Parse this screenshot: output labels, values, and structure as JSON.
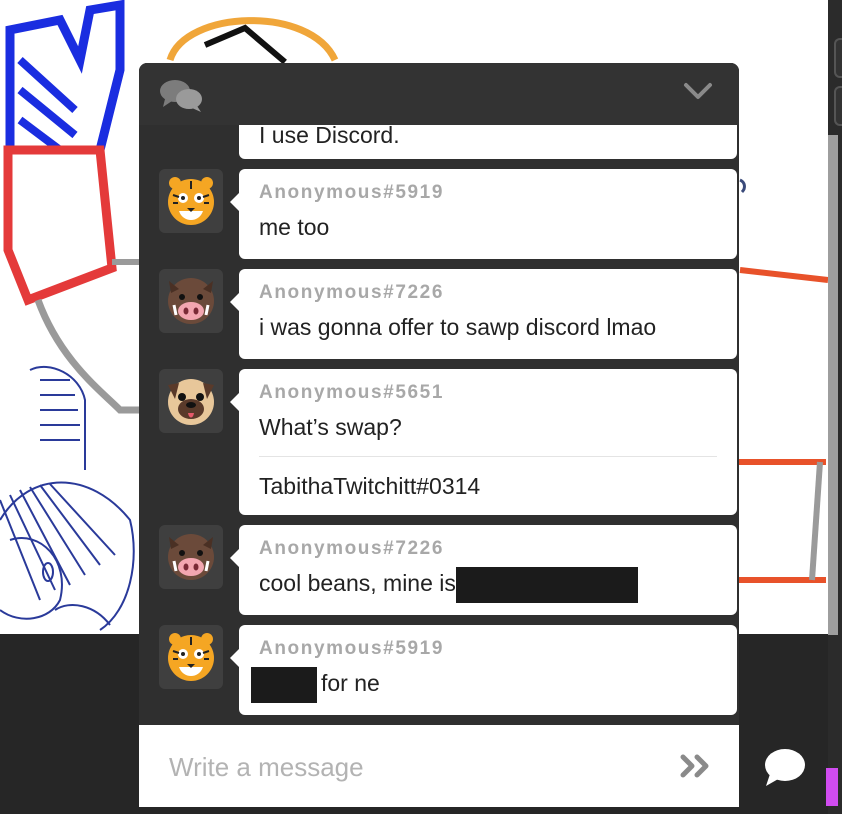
{
  "chat": {
    "header": {
      "chat_icon": "chat-bubbles-icon",
      "collapse_icon": "chevron-down-icon"
    },
    "messages": [
      {
        "author": "",
        "avatar": "",
        "text": "I use Discord.",
        "partial": true
      },
      {
        "author": "Anonymous#5919",
        "avatar": "tiger-emoji",
        "text": "me too"
      },
      {
        "author": "Anonymous#7226",
        "avatar": "boar-emoji",
        "text": "i was gonna offer to sawp discord lmao"
      },
      {
        "author": "Anonymous#5651",
        "avatar": "dog-emoji",
        "text": "What’s swap?",
        "text2": "TabithaTwitchitt#0314"
      },
      {
        "author": "Anonymous#7226",
        "avatar": "boar-emoji",
        "text": "cool beans, mine is",
        "redacted_after": true
      },
      {
        "author": "Anonymous#5919",
        "avatar": "tiger-emoji",
        "text": "for ne",
        "redacted_before": true
      }
    ],
    "composer": {
      "placeholder": "Write a message",
      "send_icon": "double-chevron-right-icon"
    }
  },
  "side": {
    "speech_button_icon": "speech-bubble-icon"
  },
  "colors": {
    "panel": "#2f2f2f",
    "header": "#333333",
    "bubble": "#ffffff",
    "author_text": "#a8a8a8",
    "accent_purple": "#d04cf0"
  }
}
